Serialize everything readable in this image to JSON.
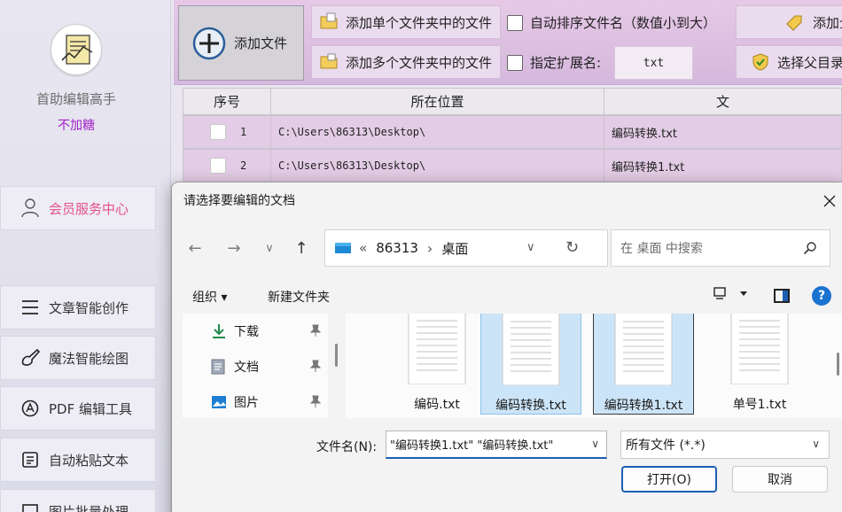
{
  "sidebar": {
    "app_name": "首助编辑高手",
    "app_sub": "不加糖",
    "items": [
      {
        "label": "会员服务中心"
      },
      {
        "label": "文章智能创作"
      },
      {
        "label": "魔法智能绘图"
      },
      {
        "label": "PDF 编辑工具"
      },
      {
        "label": "自动粘贴文本"
      },
      {
        "label": "图片批量处理"
      }
    ]
  },
  "toolbar": {
    "add_file": "添加文件",
    "add_single": "添加单个文件夹中的文件",
    "add_multi": "添加多个文件夹中的文件",
    "auto_sort": "自动排序文件名（数值小到大）",
    "specify_ext": "指定扩展名:",
    "ext_value": "txt",
    "add_all": "添加全",
    "select_parent": "选择父目录"
  },
  "table": {
    "headers": [
      "序号",
      "所在位置",
      "文"
    ],
    "rows": [
      {
        "index": "1",
        "location": "C:\\Users\\86313\\Desktop\\",
        "file": "编码转换.txt"
      },
      {
        "index": "2",
        "location": "C:\\Users\\86313\\Desktop\\",
        "file": "编码转换1.txt"
      }
    ]
  },
  "dialog": {
    "title": "请选择要编辑的文档",
    "address": {
      "prefix": "«",
      "segments": [
        "86313",
        "桌面"
      ]
    },
    "search_placeholder": "在 桌面 中搜索",
    "organize": "组织 ▾",
    "new_folder": "新建文件夹",
    "nav": [
      {
        "label": "下载"
      },
      {
        "label": "文档"
      },
      {
        "label": "图片"
      }
    ],
    "files": [
      {
        "name": "编码.txt",
        "selected": false
      },
      {
        "name": "编码转换.txt",
        "selected": true
      },
      {
        "name": "编码转换1.txt",
        "selected": true
      },
      {
        "name": "单号1.txt",
        "selected": false
      }
    ],
    "filename_label": "文件名(N):",
    "filename_value": "\"编码转换1.txt\" \"编码转换.txt\"",
    "filetype_value": "所有文件 (*.*)",
    "open_label": "打开(O)",
    "cancel_label": "取消"
  },
  "colors": {
    "accent": "#1b5fb4",
    "member": "#e5508a",
    "sub_brand": "#a323c9",
    "toolbar_bg": "#e1c5e4",
    "row_bg": "#e3cce5",
    "selected_tile": "#cce4f7"
  }
}
